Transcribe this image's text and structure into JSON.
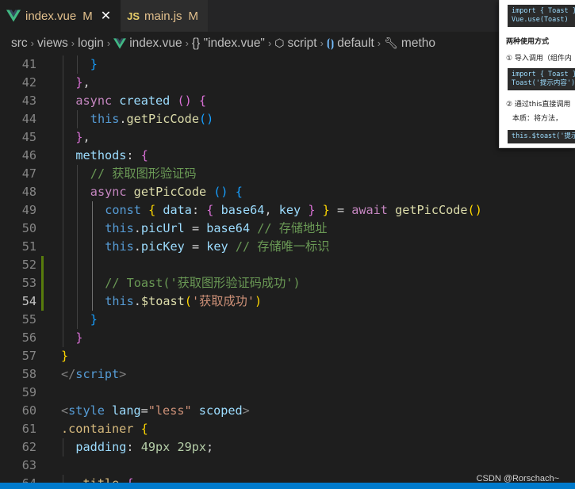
{
  "tabs": [
    {
      "label": "index.vue",
      "flag": "M",
      "close": "✕"
    },
    {
      "label": "main.js",
      "flag": "M",
      "icon_text": "JS"
    }
  ],
  "breadcrumb": [
    "src",
    "views",
    "login",
    "index.vue",
    "{} \"index.vue\"",
    "script",
    "default",
    "metho"
  ],
  "popup": {
    "code1": "import { Toast }\nVue.use(Toast)",
    "heading": "两种使用方式",
    "item1": "① 导入调用（组件内",
    "code2": "import { Toast }\nToast('提示内容')",
    "item2": "② 通过this直接调用",
    "item2_note": "本质：将方法，",
    "code3": "this.$toast('提示"
  },
  "lines": [
    {
      "n": "41",
      "ind": 2,
      "t": [
        [
          "}",
          "br3"
        ]
      ]
    },
    {
      "n": "42",
      "ind": 1,
      "t": [
        [
          "}",
          "br2"
        ],
        [
          ",",
          "pun"
        ]
      ]
    },
    {
      "n": "43",
      "ind": 1,
      "t": [
        [
          "async",
          "kw"
        ],
        [
          " ",
          "pun"
        ],
        [
          "created",
          "prop"
        ],
        [
          " ",
          "pun"
        ],
        [
          "()",
          "br2"
        ],
        [
          " ",
          "pun"
        ],
        [
          "{",
          "br2"
        ]
      ]
    },
    {
      "n": "44",
      "ind": 2,
      "t": [
        [
          "this",
          "this"
        ],
        [
          ".",
          "pun"
        ],
        [
          "getPicCode",
          "fn"
        ],
        [
          "()",
          "br3"
        ]
      ]
    },
    {
      "n": "45",
      "ind": 1,
      "t": [
        [
          "}",
          "br2"
        ],
        [
          ",",
          "pun"
        ]
      ]
    },
    {
      "n": "46",
      "ind": 1,
      "t": [
        [
          "methods",
          "prop"
        ],
        [
          ": ",
          "pun"
        ],
        [
          "{",
          "br2"
        ]
      ]
    },
    {
      "n": "47",
      "ind": 2,
      "t": [
        [
          "// 获取图形验证码",
          "cm"
        ]
      ]
    },
    {
      "n": "48",
      "ind": 2,
      "t": [
        [
          "async",
          "kw"
        ],
        [
          " ",
          "pun"
        ],
        [
          "getPicCode",
          "fn"
        ],
        [
          " ",
          "pun"
        ],
        [
          "()",
          "br3"
        ],
        [
          " ",
          "pun"
        ],
        [
          "{",
          "br3"
        ]
      ]
    },
    {
      "n": "49",
      "ind": 3,
      "t": [
        [
          "const",
          "kwb"
        ],
        [
          " ",
          "pun"
        ],
        [
          "{",
          "br1"
        ],
        [
          " ",
          "pun"
        ],
        [
          "data",
          "prop"
        ],
        [
          ": ",
          "pun"
        ],
        [
          "{",
          "br2"
        ],
        [
          " ",
          "pun"
        ],
        [
          "base64",
          "prop"
        ],
        [
          ", ",
          "pun"
        ],
        [
          "key",
          "prop"
        ],
        [
          " ",
          "pun"
        ],
        [
          "}",
          "br2"
        ],
        [
          " ",
          "pun"
        ],
        [
          "}",
          "br1"
        ],
        [
          " = ",
          "pun"
        ],
        [
          "await",
          "kw"
        ],
        [
          " ",
          "pun"
        ],
        [
          "getPicCode",
          "fn"
        ],
        [
          "()",
          "br1"
        ]
      ]
    },
    {
      "n": "50",
      "ind": 3,
      "t": [
        [
          "this",
          "this"
        ],
        [
          ".",
          "pun"
        ],
        [
          "picUrl",
          "prop"
        ],
        [
          " = ",
          "pun"
        ],
        [
          "base64",
          "prop"
        ],
        [
          " ",
          "pun"
        ],
        [
          "// 存储地址",
          "cm"
        ]
      ]
    },
    {
      "n": "51",
      "ind": 3,
      "t": [
        [
          "this",
          "this"
        ],
        [
          ".",
          "pun"
        ],
        [
          "picKey",
          "prop"
        ],
        [
          " = ",
          "pun"
        ],
        [
          "key",
          "prop"
        ],
        [
          " ",
          "pun"
        ],
        [
          "// 存储唯一标识",
          "cm"
        ]
      ]
    },
    {
      "n": "52",
      "ind": 3,
      "t": []
    },
    {
      "n": "53",
      "ind": 3,
      "t": [
        [
          "// Toast('获取图形验证码成功')",
          "cm"
        ]
      ]
    },
    {
      "n": "54",
      "ind": 3,
      "cur": true,
      "t": [
        [
          "this",
          "this"
        ],
        [
          ".",
          "pun"
        ],
        [
          "$toast",
          "fn"
        ],
        [
          "(",
          "br1"
        ],
        [
          "'获取成功'",
          "str"
        ],
        [
          ")",
          "br1"
        ]
      ]
    },
    {
      "n": "55",
      "ind": 2,
      "t": [
        [
          "}",
          "br3"
        ]
      ]
    },
    {
      "n": "56",
      "ind": 1,
      "t": [
        [
          "}",
          "br2"
        ]
      ]
    },
    {
      "n": "57",
      "ind": 0,
      "t": [
        [
          "}",
          "br1"
        ]
      ]
    },
    {
      "n": "58",
      "ind": 0,
      "t": [
        [
          "</",
          "tag"
        ],
        [
          "script",
          "tagname"
        ],
        [
          ">",
          "tag"
        ]
      ]
    },
    {
      "n": "59",
      "ind": 0,
      "t": []
    },
    {
      "n": "60",
      "ind": 0,
      "t": [
        [
          "<",
          "tag"
        ],
        [
          "style",
          "tagname"
        ],
        [
          " ",
          "pun"
        ],
        [
          "lang",
          "attr"
        ],
        [
          "=",
          "pun"
        ],
        [
          "\"less\"",
          "str"
        ],
        [
          " ",
          "pun"
        ],
        [
          "scoped",
          "attr"
        ],
        [
          ">",
          "tag"
        ]
      ]
    },
    {
      "n": "61",
      "ind": 0,
      "t": [
        [
          ".container",
          "sel"
        ],
        [
          " ",
          "pun"
        ],
        [
          "{",
          "br1"
        ]
      ]
    },
    {
      "n": "62",
      "ind": 1,
      "t": [
        [
          "padding",
          "attr"
        ],
        [
          ": ",
          "pun"
        ],
        [
          "49px",
          "num"
        ],
        [
          " ",
          "pun"
        ],
        [
          "29px",
          "num"
        ],
        [
          ";",
          "pun"
        ]
      ]
    },
    {
      "n": "63",
      "ind": 0,
      "t": []
    },
    {
      "n": "64",
      "ind": 1,
      "t": [
        [
          ".title",
          "sel"
        ],
        [
          " ",
          "pun"
        ],
        [
          "{",
          "br2"
        ]
      ]
    }
  ],
  "watermark": "CSDN @Rorschach~"
}
